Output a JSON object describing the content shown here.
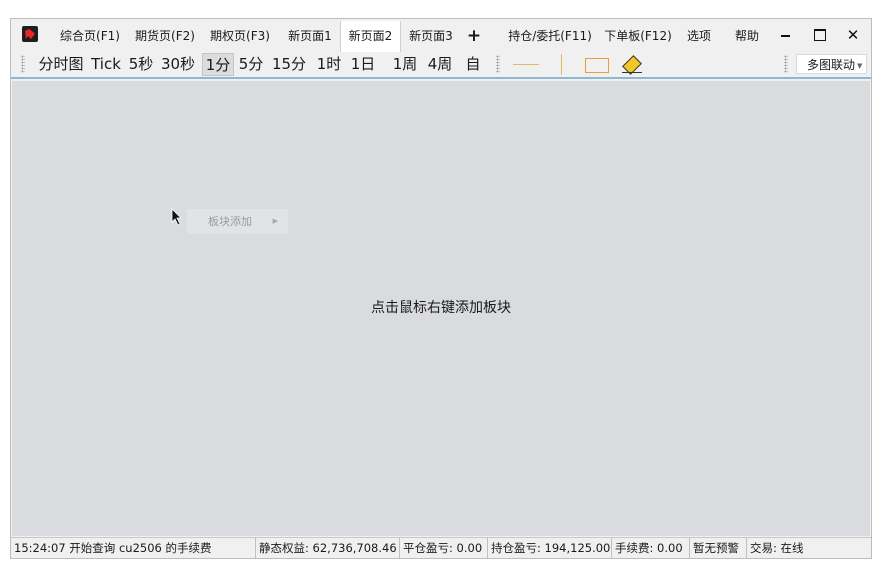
{
  "titlebar": {
    "tabs": [
      {
        "label": "综合页(F1)"
      },
      {
        "label": "期货页(F2)"
      },
      {
        "label": "期权页(F3)"
      },
      {
        "label": "新页面1"
      },
      {
        "label": "新页面2"
      },
      {
        "label": "新页面3"
      },
      {
        "label": "+"
      },
      {
        "label": "持仓/委托(F11)"
      },
      {
        "label": "下单板(F12)"
      },
      {
        "label": "选项"
      },
      {
        "label": "帮助"
      }
    ],
    "active_tab": "新页面2",
    "close_glyph": "✕"
  },
  "toolbar": {
    "periods": [
      {
        "label": "分时图"
      },
      {
        "label": "Tick"
      },
      {
        "label": "5秒"
      },
      {
        "label": "30秒"
      },
      {
        "label": "1分"
      },
      {
        "label": "5分"
      },
      {
        "label": "15分"
      },
      {
        "label": "1时"
      },
      {
        "label": "1日"
      },
      {
        "label": "1周"
      },
      {
        "label": "4周"
      },
      {
        "label": "自"
      }
    ],
    "selected_period": "1分",
    "drawing_tools": [
      "line-tool",
      "rectangle-tool",
      "eraser-tool"
    ],
    "multi_chart_label": "多图联动",
    "caret_glyph": "▼"
  },
  "main": {
    "context_menu": {
      "label": "板块添加",
      "arrow": "▶"
    },
    "hint": "点击鼠标右键添加板块"
  },
  "statusbar": {
    "message": "15:24:07 开始查询 cu2506 的手续费",
    "static_equity": "静态权益: 62,736,708.46",
    "close_pnl": "平仓盈亏: 0.00",
    "position_pnl": "持仓盈亏: 194,125.00",
    "fee": "手续费: 0.00",
    "alert": "暂无预警",
    "trade_status": "交易: 在线"
  },
  "colors": {
    "background": "#d9dbdf",
    "toolbar_border": "#8fb6d2",
    "logo_red": "#e8262b",
    "drawing_tool": "#e0b86a"
  }
}
